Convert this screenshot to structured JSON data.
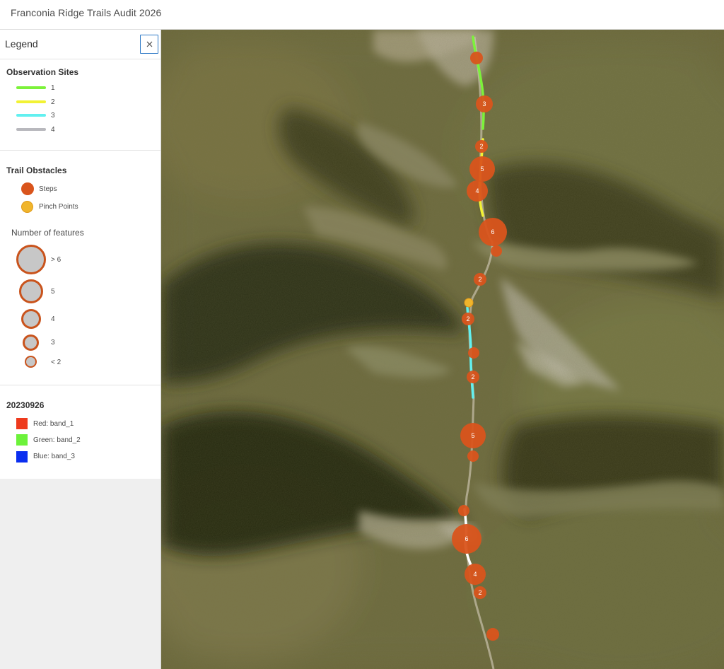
{
  "app": {
    "title": "Franconia Ridge Trails Audit 2026"
  },
  "legend": {
    "title": "Legend",
    "close_icon": "close-icon",
    "observation_sites": {
      "title": "Observation Sites",
      "items": [
        {
          "label": "1",
          "color": "#7cf23a"
        },
        {
          "label": "2",
          "color": "#f2f234"
        },
        {
          "label": "3",
          "color": "#62f0f0"
        },
        {
          "label": "4",
          "color": "#b8b8bd"
        }
      ]
    },
    "trail_obstacles": {
      "title": "Trail Obstacles",
      "items": [
        {
          "label": "Steps",
          "color": "#d9541c"
        },
        {
          "label": "Pinch Points",
          "color": "#f0b52c"
        }
      ]
    },
    "feature_count": {
      "title": "Number of features",
      "classes": [
        "> 6",
        "5",
        "4",
        "3",
        "< 2"
      ]
    },
    "raster": {
      "title": "20230926",
      "bands": [
        {
          "label": "Red: band_1",
          "color": "#ee3a1d"
        },
        {
          "label": "Green: band_2",
          "color": "#6cf23a"
        },
        {
          "label": "Blue: band_3",
          "color": "#0a2ef0"
        }
      ]
    }
  },
  "map": {
    "basemap": "aerial imagery of mountain ridge",
    "trails": [
      {
        "site": "1",
        "color": "#7cf23a"
      },
      {
        "site": "2",
        "color": "#f2f234"
      },
      {
        "site": "3",
        "color": "#62f0f0"
      },
      {
        "site": "4",
        "color": "#ffffff"
      }
    ],
    "obstacle_clusters": [
      {
        "type": "Steps",
        "count": null
      },
      {
        "type": "Steps",
        "count": 3
      },
      {
        "type": "Steps",
        "count": 2
      },
      {
        "type": "Steps",
        "count": 5
      },
      {
        "type": "Steps",
        "count": 4
      },
      {
        "type": "Steps",
        "count": 6
      },
      {
        "type": "Steps",
        "count": null
      },
      {
        "type": "Steps",
        "count": 2
      },
      {
        "type": "Pinch Points",
        "count": null
      },
      {
        "type": "Steps",
        "count": 2
      },
      {
        "type": "Steps",
        "count": null
      },
      {
        "type": "Steps",
        "count": 2
      },
      {
        "type": "Steps",
        "count": 5
      },
      {
        "type": "Steps",
        "count": null
      },
      {
        "type": "Steps",
        "count": null
      },
      {
        "type": "Steps",
        "count": 6
      },
      {
        "type": "Steps",
        "count": 4
      },
      {
        "type": "Steps",
        "count": 2
      },
      {
        "type": "Steps",
        "count": null
      }
    ]
  }
}
